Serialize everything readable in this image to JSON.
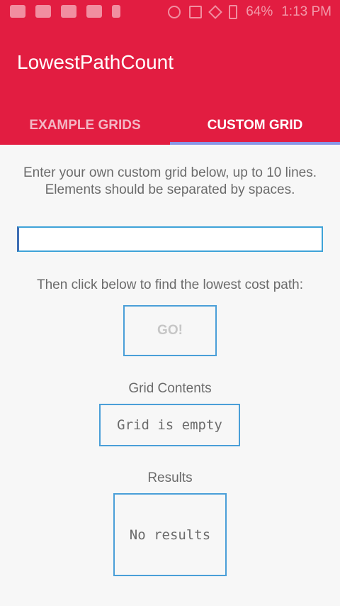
{
  "status_bar": {
    "battery": "64%",
    "time": "1:13 PM"
  },
  "app": {
    "title": "LowestPathCount",
    "accent_color": "#e21d41",
    "tab_indicator_color": "#8a96e6"
  },
  "tabs": [
    {
      "label": "EXAMPLE GRIDS",
      "selected": false
    },
    {
      "label": "CUSTOM GRID",
      "selected": true
    }
  ],
  "custom_grid": {
    "description": "Enter your own custom grid below, up to 10 lines. Elements should be separated by spaces.",
    "input_value": "",
    "instruction": "Then click below to find the lowest cost path:",
    "go_label": "GO!",
    "grid_contents_label": "Grid Contents",
    "grid_contents_value": "Grid is empty",
    "results_label": "Results",
    "results_value": "No results"
  }
}
